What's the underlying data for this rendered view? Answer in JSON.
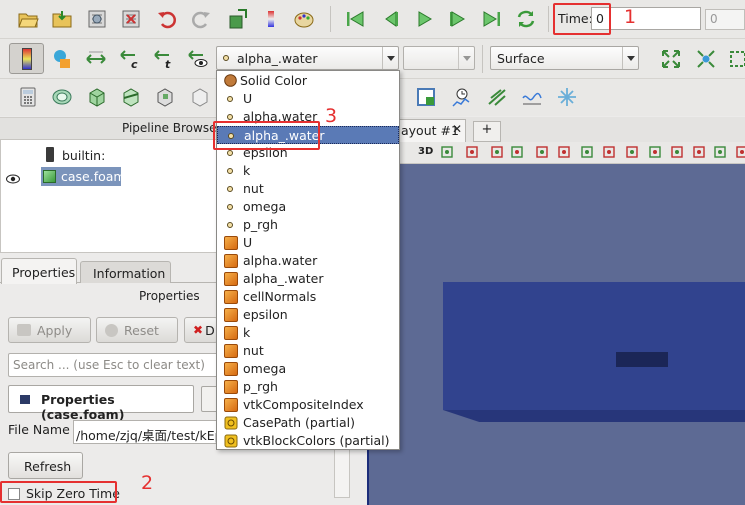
{
  "toolbar": {
    "time_label": "Time:",
    "time_value": "0",
    "time_index": "0",
    "active_array": "alpha_.water",
    "representation": "Surface"
  },
  "array_dropdown": {
    "items": [
      {
        "label": "Solid Color",
        "marker": "solid"
      },
      {
        "label": "U",
        "marker": "point"
      },
      {
        "label": "alpha.water",
        "marker": "point"
      },
      {
        "label": "alpha_.water",
        "marker": "point"
      },
      {
        "label": "epsilon",
        "marker": "point"
      },
      {
        "label": "k",
        "marker": "point"
      },
      {
        "label": "nut",
        "marker": "point"
      },
      {
        "label": "omega",
        "marker": "point"
      },
      {
        "label": "p_rgh",
        "marker": "point"
      },
      {
        "label": "U",
        "marker": "cell"
      },
      {
        "label": "alpha.water",
        "marker": "cell"
      },
      {
        "label": "alpha_.water",
        "marker": "cell"
      },
      {
        "label": "cellNormals",
        "marker": "cell"
      },
      {
        "label": "epsilon",
        "marker": "cell"
      },
      {
        "label": "k",
        "marker": "cell"
      },
      {
        "label": "nut",
        "marker": "cell"
      },
      {
        "label": "omega",
        "marker": "cell"
      },
      {
        "label": "p_rgh",
        "marker": "cell"
      },
      {
        "label": "vtkCompositeIndex",
        "marker": "cell"
      },
      {
        "label": "CasePath (partial)",
        "marker": "field"
      },
      {
        "label": "vtkBlockColors (partial)",
        "marker": "field"
      }
    ],
    "selected_index": 3
  },
  "pipeline": {
    "title": "Pipeline Browser",
    "items": [
      {
        "label": "builtin:"
      },
      {
        "label": "case.foam"
      }
    ]
  },
  "tabs": {
    "properties": "Properties",
    "information": "Information"
  },
  "properties_panel": {
    "header": "Properties",
    "apply": "Apply",
    "reset": "Reset",
    "delete_partial": "D",
    "search_placeholder": "Search ... (use Esc to clear text)",
    "section_title": "Properties (case.foam)",
    "file_name_label": "File Name",
    "file_name_value": "/home/zjq/桌面/test/kEps",
    "refresh": "Refresh",
    "skip_zero_time": "Skip Zero Time"
  },
  "render_view": {
    "tab_label": "ayout #1",
    "add_tab": "+",
    "view_3d": "3D"
  },
  "annotations": [
    "1",
    "2",
    "3"
  ],
  "colors": {
    "accent": "#5a7ab6",
    "annotation": "#e53030",
    "render_bg": "#5d6a94",
    "box": "#31438e"
  }
}
